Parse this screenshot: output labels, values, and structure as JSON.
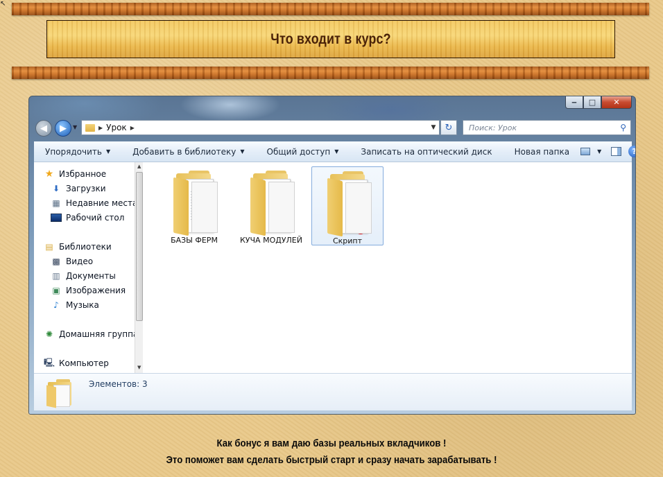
{
  "page": {
    "title": "Что входит в курс?",
    "bonus_line1": "Как бонус я вам даю базы реальных вкладчиков !",
    "bonus_line2": "Это поможет вам сделать быстрый старт и сразу начать зарабатывать !"
  },
  "explorer": {
    "address": {
      "crumb": "Урок"
    },
    "search": {
      "placeholder": "Поиск: Урок"
    },
    "toolbar": {
      "organize": "Упорядочить",
      "add_to_library": "Добавить в библиотеку",
      "share": "Общий доступ",
      "burn": "Записать на оптический диск",
      "new_folder": "Новая папка"
    },
    "nav": {
      "favorites": "Избранное",
      "downloads": "Загрузки",
      "recent": "Недавние места",
      "desktop": "Рабочий стол",
      "libraries": "Библиотеки",
      "video": "Видео",
      "documents": "Документы",
      "images": "Изображения",
      "music": "Музыка",
      "homegroup": "Домашняя группа",
      "computer": "Компьютер"
    },
    "files": [
      {
        "name": "БАЗЫ ФЕРМ"
      },
      {
        "name": "КУЧА МОДУЛЕЙ"
      },
      {
        "name": "Скрипт"
      }
    ],
    "details": {
      "count": "Элементов: 3"
    }
  },
  "colors": {
    "accent": "#2b62b8",
    "banner": "#f3c860",
    "plank": "#c46a22"
  }
}
